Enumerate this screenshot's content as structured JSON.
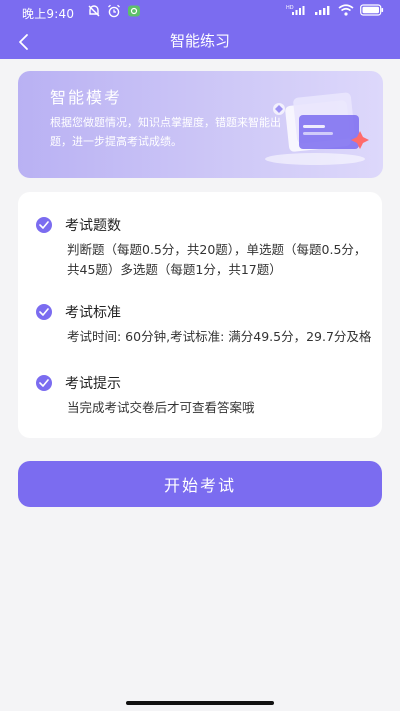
{
  "status_bar": {
    "time": "晚上9:40",
    "battery": "battery-icon",
    "signal_label": "HD"
  },
  "nav": {
    "title": "智能练习",
    "back_icon": "chevron-left-icon"
  },
  "banner": {
    "title": "智能模考",
    "description": "根据您做题情况，知识点掌握度，错题来智能出题，进一步提高考试成绩。"
  },
  "sections": [
    {
      "title": "考试题数",
      "body": "判断题（每题0.5分，共20题），单选题（每题0.5分，共45题）多选题（每题1分，共17题）"
    },
    {
      "title": "考试标准",
      "body": "考试时间: 60分钟,考试标准: 满分49.5分，29.7分及格"
    },
    {
      "title": "考试提示",
      "body": "当完成考试交卷后才可查看答案哦"
    }
  ],
  "start_button": {
    "label": "开始考试"
  },
  "colors": {
    "accent": "#7b6cf0",
    "background": "#f4f4f6",
    "card": "#ffffff"
  }
}
